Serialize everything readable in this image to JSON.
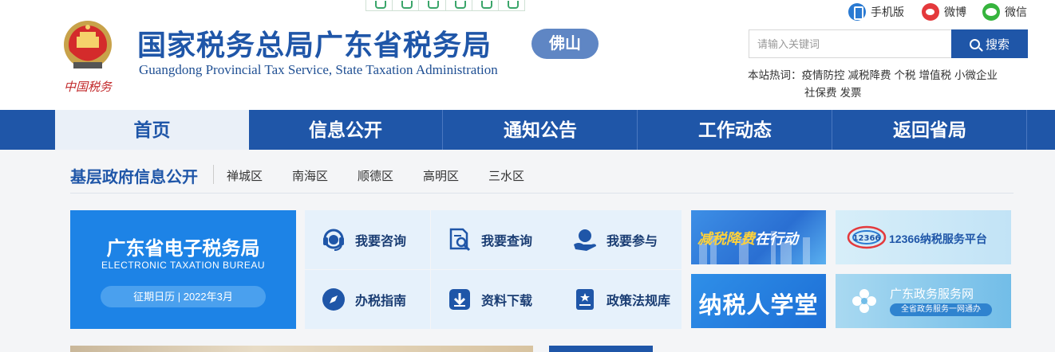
{
  "header": {
    "title_cn": "国家税务总局广东省税务局",
    "title_en": "Guangdong Provincial Tax Service, State Taxation Administration",
    "city_badge": "佛山",
    "emblem_text": "中国税务"
  },
  "social": {
    "mobile": "手机版",
    "weibo": "微博",
    "wechat": "微信"
  },
  "search": {
    "placeholder": "请输入关键词",
    "button": "搜索"
  },
  "hotwords": {
    "label": "本站热词：",
    "items": [
      "疫情防控",
      "减税降费",
      "个税",
      "增值税",
      "小微企业",
      "社保费",
      "发票"
    ]
  },
  "nav": {
    "items": [
      "首页",
      "信息公开",
      "通知公告",
      "工作动态",
      "返回省局"
    ],
    "active_index": 0
  },
  "subnav": {
    "title": "基层政府信息公开",
    "items": [
      "禅城区",
      "南海区",
      "顺德区",
      "高明区",
      "三水区"
    ]
  },
  "etb": {
    "title": "广东省电子税务局",
    "subtitle": "ELECTRONIC TAXATION BUREAU",
    "calendar": "征期日历 | 2022年3月"
  },
  "services": [
    {
      "label": "我要咨询",
      "icon": "headset-icon"
    },
    {
      "label": "我要查询",
      "icon": "document-search-icon"
    },
    {
      "label": "我要参与",
      "icon": "hand-participate-icon"
    },
    {
      "label": "办税指南",
      "icon": "compass-icon"
    },
    {
      "label": "资料下载",
      "icon": "download-icon"
    },
    {
      "label": "政策法规库",
      "icon": "law-book-icon"
    }
  ],
  "banners": {
    "tax_cut_part1": "减税降费",
    "tax_cut_part2": "在行动",
    "hotline_logo": "12366",
    "hotline": "12366纳税服务平台",
    "school": "纳税人学堂",
    "gov_service": "广东政务服务网",
    "gov_service_sub": "全省政务服务一网通办"
  },
  "colors": {
    "primary": "#1f56a8",
    "etb_blue": "#1d83e6",
    "tile_bg": "#e6f1fb",
    "tax_highlight": "#ffd23a"
  }
}
